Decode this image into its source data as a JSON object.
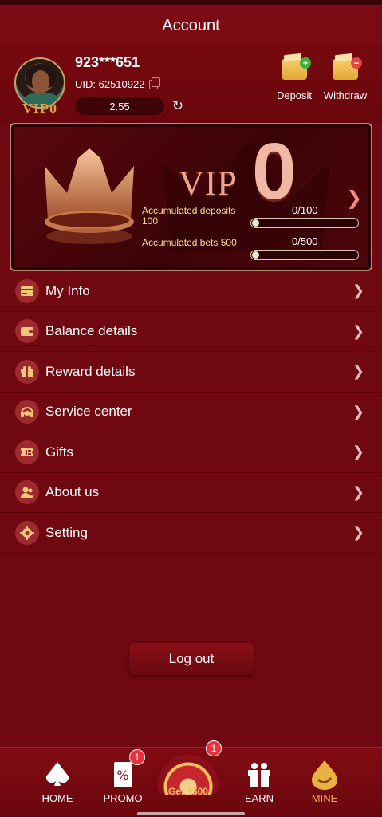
{
  "header": {
    "title": "Account"
  },
  "profile": {
    "username": "923***651",
    "uid_label": "UID: 62510922",
    "vip_tag": "VIP0",
    "balance": "2.55"
  },
  "actions": {
    "deposit_label": "Deposit",
    "withdraw_label": "Withdraw"
  },
  "vip_card": {
    "vip_word": "VIP",
    "level": "0",
    "accumulated_deposit_label": "Accumulated deposits 100",
    "accumulated_deposit_value": "0/100",
    "accumulated_deposit_progress": 0,
    "accumulated_bets_label": "Accumulated bets 500",
    "accumulated_bets_value": "0/500",
    "accumulated_bets_progress": 0
  },
  "menu": {
    "items": [
      {
        "label": "My Info",
        "icon": "card-icon"
      },
      {
        "label": "Balance details",
        "icon": "wallet-icon"
      },
      {
        "label": "Reward details",
        "icon": "gift-box-icon"
      },
      {
        "label": "Service center",
        "icon": "headset-icon"
      },
      {
        "label": "Gifts",
        "icon": "ticket-icon"
      },
      {
        "label": "About us",
        "icon": "users-icon"
      },
      {
        "label": "Setting",
        "icon": "gear-icon"
      }
    ]
  },
  "logout_label": "Log out",
  "tabbar": {
    "home": "HOME",
    "promo": "PROMO",
    "promo_badge": "1",
    "center_label": "Get 1500",
    "center_badge": "1",
    "earn": "EARN",
    "mine": "MINE"
  },
  "colors": {
    "background": "#6f0810",
    "accent_gold": "#e9b042",
    "badge_red": "#e7323d"
  }
}
